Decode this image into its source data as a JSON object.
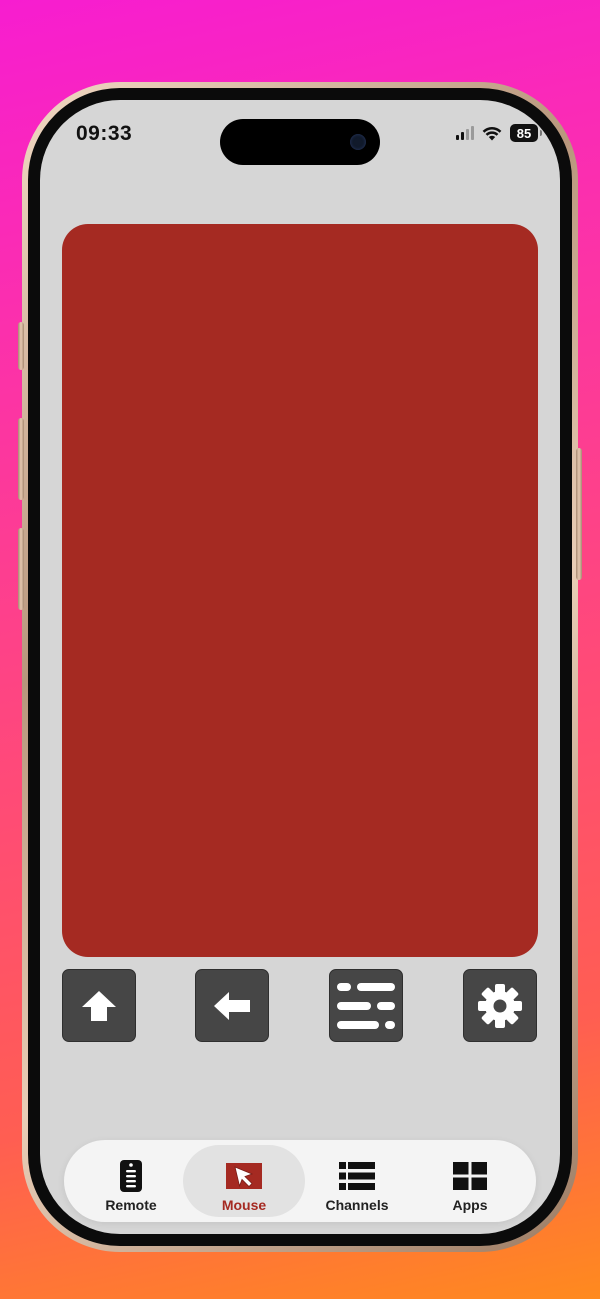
{
  "status_bar": {
    "time": "09:33",
    "battery_level": "85",
    "signal_bars_active": 2,
    "signal_bars_total": 4
  },
  "trackpad": {
    "color": "#a52a22"
  },
  "controls": [
    {
      "name": "home",
      "icon": "arrow-up-home-icon"
    },
    {
      "name": "back",
      "icon": "arrow-left-back-icon"
    },
    {
      "name": "menu",
      "icon": "options-list-icon"
    },
    {
      "name": "settings",
      "icon": "gear-icon"
    }
  ],
  "tabs": [
    {
      "label": "Remote",
      "icon": "remote-icon",
      "active": false
    },
    {
      "label": "Mouse",
      "icon": "mouse-pointer-icon",
      "active": true
    },
    {
      "label": "Channels",
      "icon": "numbered-list-icon",
      "active": false
    },
    {
      "label": "Apps",
      "icon": "grid-icon",
      "active": false
    }
  ],
  "colors": {
    "accent": "#a52a22",
    "button_bg": "#464646",
    "screen_bg": "#d6d6d6",
    "tabbar_bg": "#f4f4f4"
  }
}
